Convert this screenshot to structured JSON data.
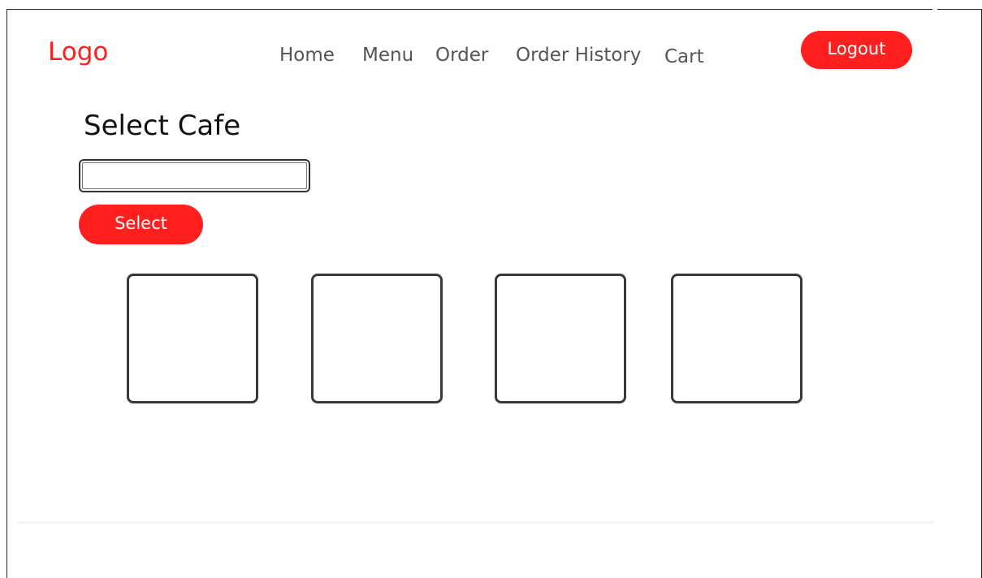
{
  "header": {
    "logo": "Logo",
    "nav": {
      "home": "Home",
      "menu": "Menu",
      "order": "Order",
      "order_history": "Order History",
      "cart": "Cart"
    },
    "logout_label": "Logout"
  },
  "main": {
    "title": "Select Cafe",
    "cafe_input": {
      "value": "",
      "placeholder": ""
    },
    "select_label": "Select",
    "cafe_cards": [
      {
        "label": ""
      },
      {
        "label": ""
      },
      {
        "label": ""
      },
      {
        "label": ""
      }
    ]
  },
  "colors": {
    "accent": "#ff1f1f",
    "nav_text": "#555555",
    "title_text": "#111111",
    "card_border": "#3a3a3a"
  }
}
